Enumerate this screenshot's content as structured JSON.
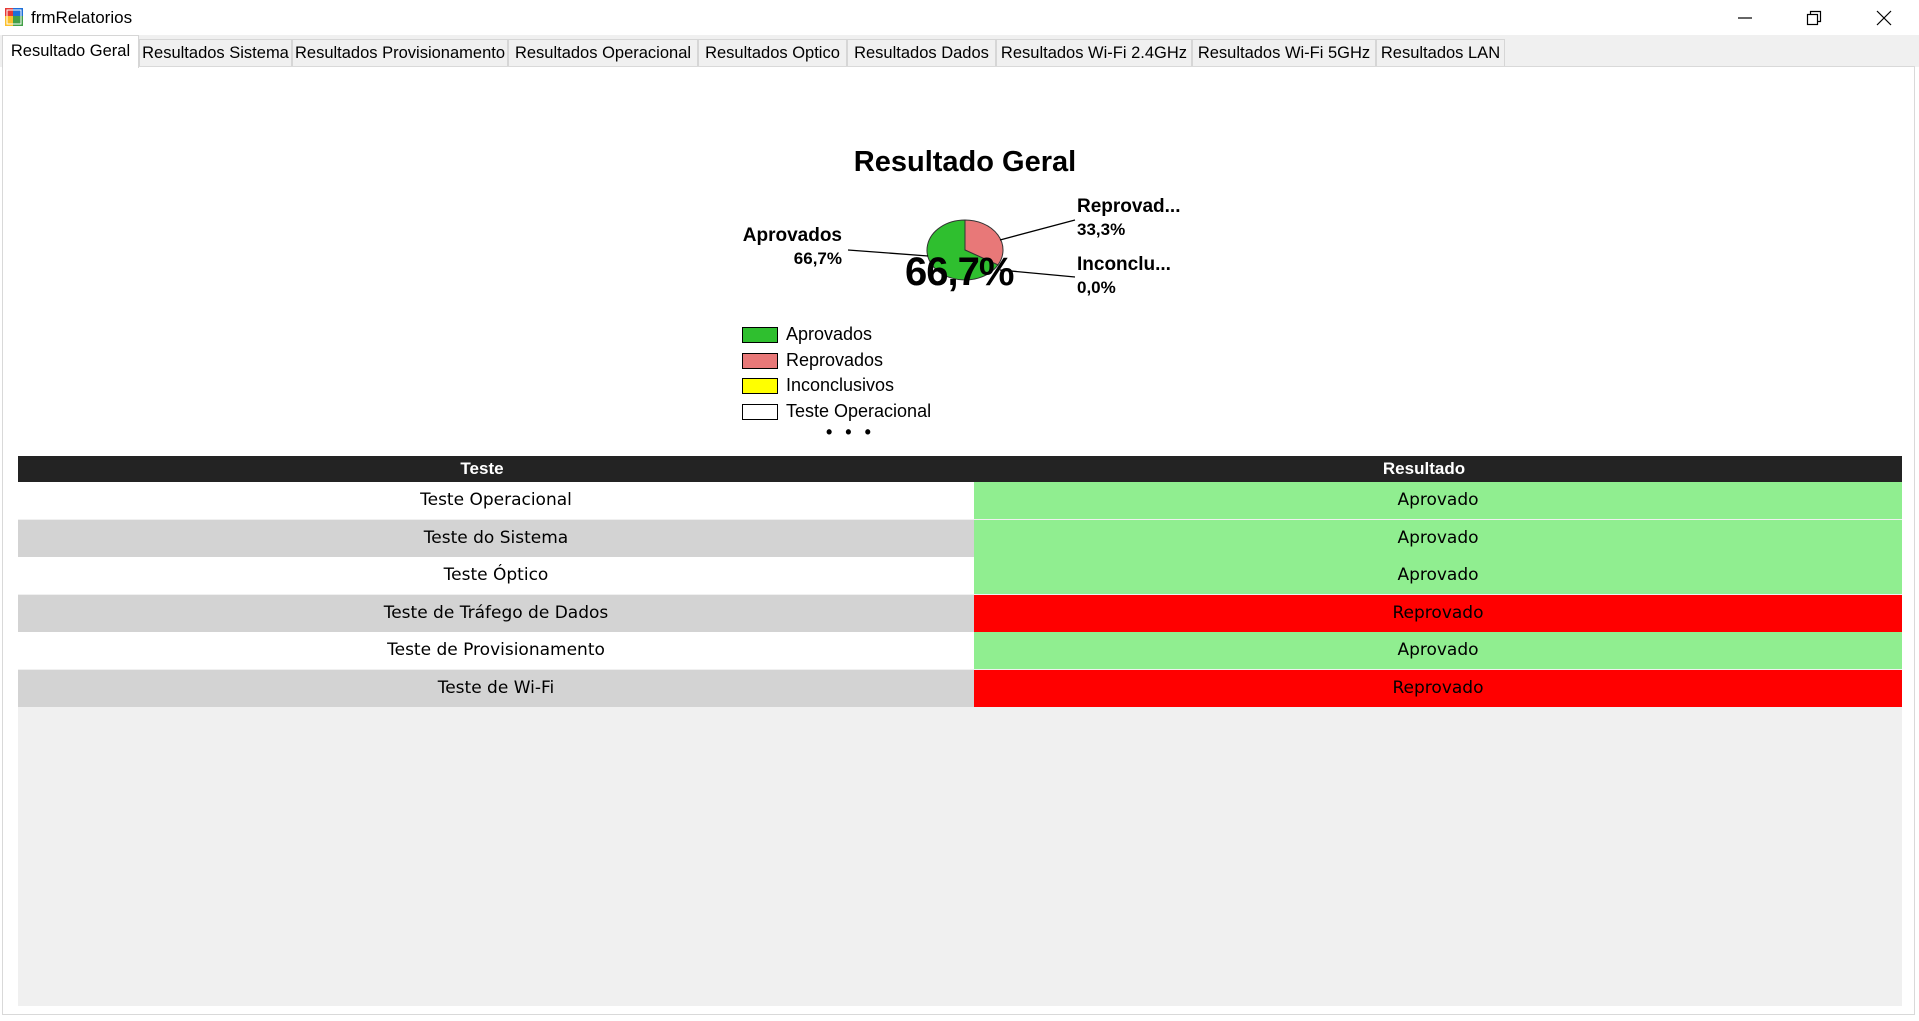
{
  "window": {
    "title": "frmRelatorios"
  },
  "tabs": [
    {
      "label": "Resultado Geral",
      "active": true
    },
    {
      "label": "Resultados Sistema",
      "active": false
    },
    {
      "label": "Resultados Provisionamento",
      "active": false
    },
    {
      "label": "Resultados Operacional",
      "active": false
    },
    {
      "label": "Resultados Optico",
      "active": false
    },
    {
      "label": "Resultados Dados",
      "active": false
    },
    {
      "label": "Resultados Wi-Fi 2.4GHz",
      "active": false
    },
    {
      "label": "Resultados Wi-Fi 5GHz",
      "active": false
    },
    {
      "label": "Resultados LAN",
      "active": false
    }
  ],
  "chart_data": {
    "type": "pie",
    "title": "Resultado Geral",
    "center_label": "66,7%",
    "slices": [
      {
        "name": "Aprovados",
        "label": "Aprovados",
        "value": 66.7,
        "percent_text": "66,7%",
        "color": "#2fbf2f"
      },
      {
        "name": "Reprovados",
        "label": "Reprovad...",
        "value": 33.3,
        "percent_text": "33,3%",
        "color": "#e87878"
      },
      {
        "name": "Inconclusivos",
        "label": "Inconclu...",
        "value": 0.0,
        "percent_text": "0,0%",
        "color": "#ffff00"
      }
    ],
    "legend": [
      {
        "label": "Aprovados",
        "color": "#2fbf2f"
      },
      {
        "label": "Reprovados",
        "color": "#e87878"
      },
      {
        "label": "Inconclusivos",
        "color": "#ffff00"
      },
      {
        "label": "Teste Operacional",
        "color": "#ffffff"
      }
    ],
    "legend_more": "• • •",
    "legend_placement": "bottom-left"
  },
  "grid": {
    "columns": [
      "Teste",
      "Resultado"
    ],
    "rows": [
      {
        "test": "Teste Operacional",
        "result": "Aprovado",
        "status": "pass"
      },
      {
        "test": "Teste do Sistema",
        "result": "Aprovado",
        "status": "pass"
      },
      {
        "test": "Teste Óptico",
        "result": "Aprovado",
        "status": "pass"
      },
      {
        "test": "Teste de Tráfego de Dados",
        "result": "Reprovado",
        "status": "fail"
      },
      {
        "test": "Teste de Provisionamento",
        "result": "Aprovado",
        "status": "pass"
      },
      {
        "test": "Teste de Wi-Fi",
        "result": "Reprovado",
        "status": "fail"
      }
    ]
  },
  "colors": {
    "pass": "#90ee90",
    "fail": "#ff0000",
    "row_alt": "#d3d3d3",
    "row": "#ffffff",
    "header": "#232323"
  },
  "icons": {
    "app": "app-icon",
    "minimize": "minimize-icon",
    "restore": "restore-icon",
    "close": "close-icon"
  }
}
